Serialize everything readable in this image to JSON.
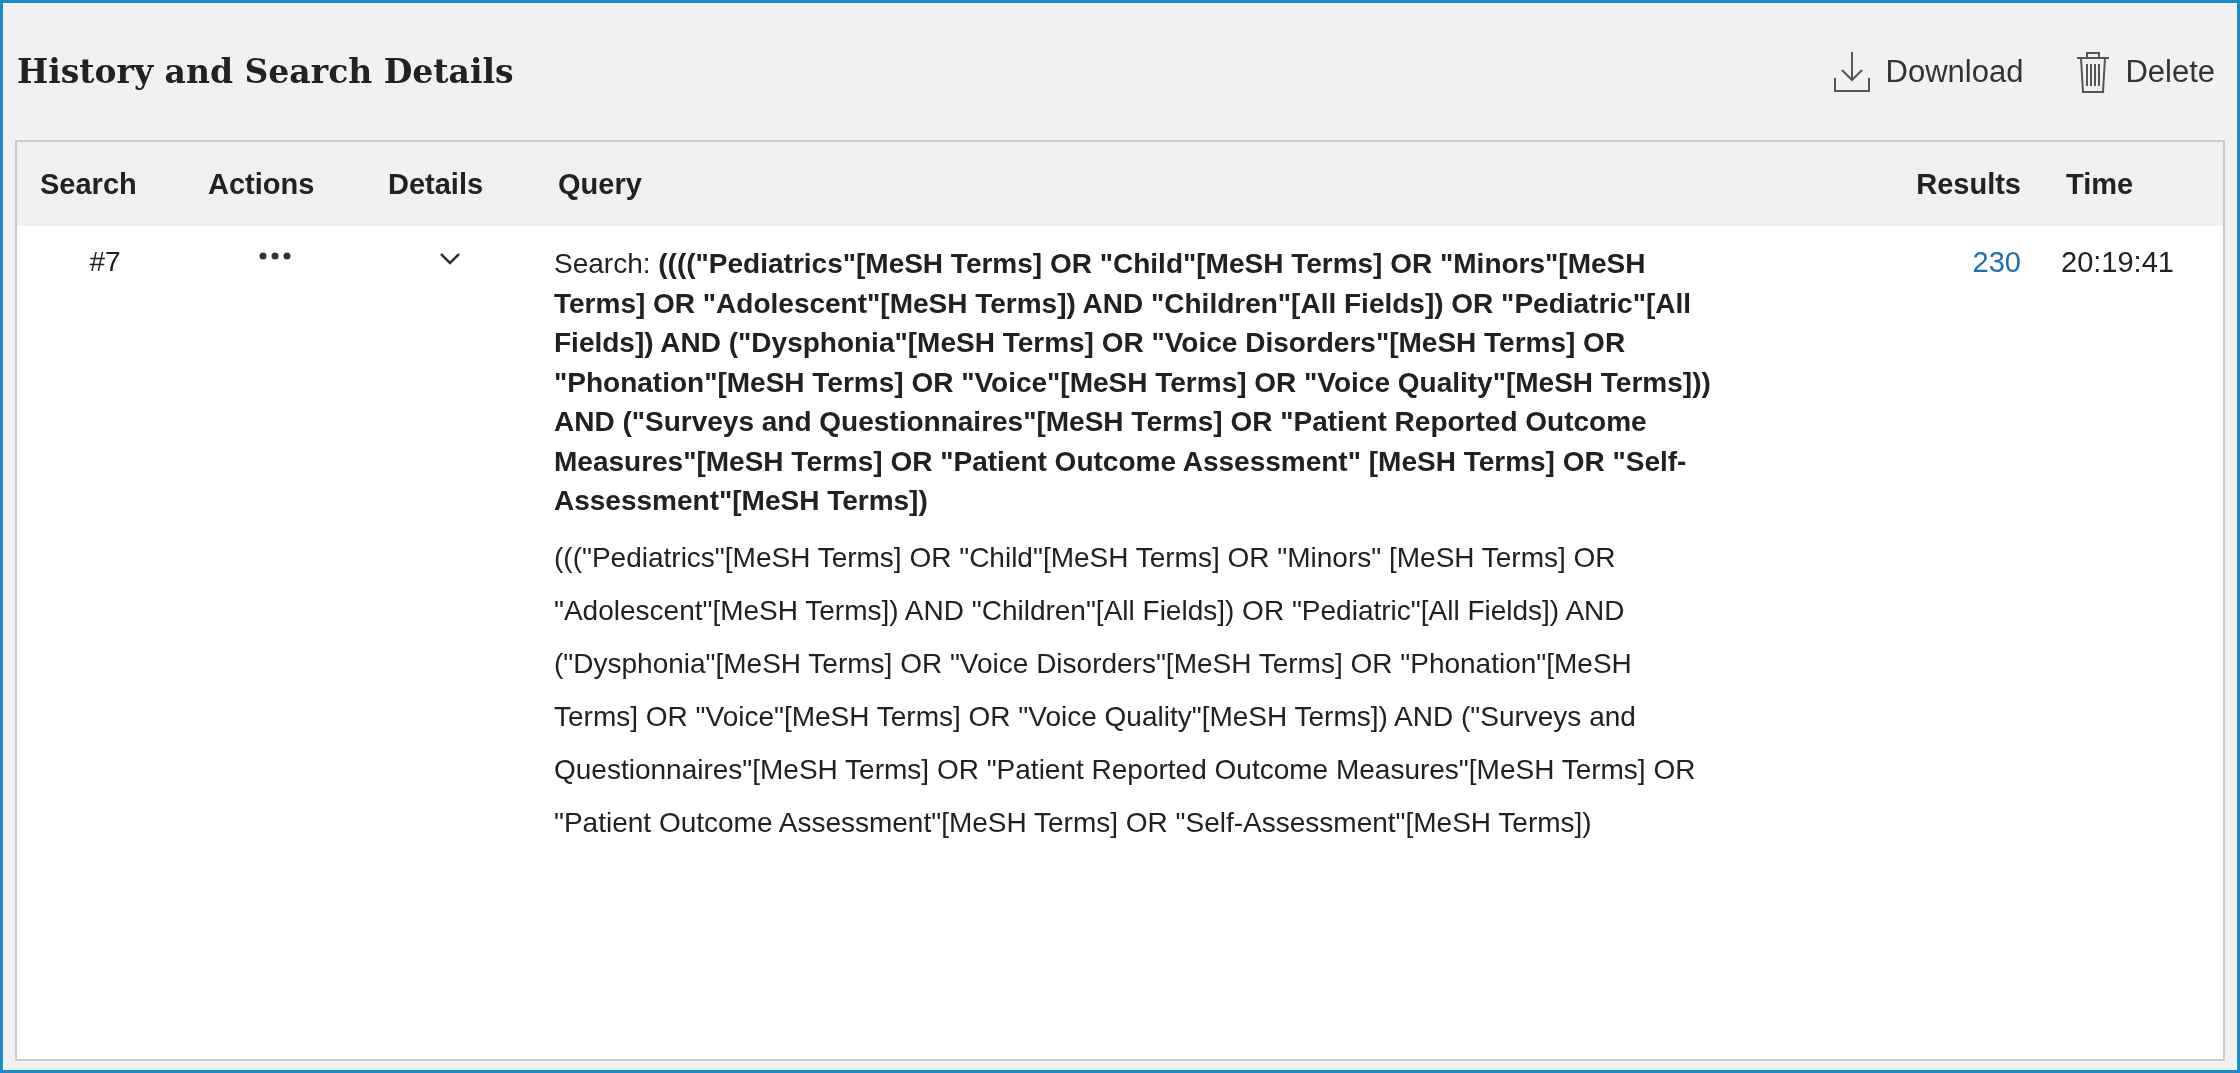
{
  "panel": {
    "title": "History and Search Details",
    "actions": [
      {
        "kind": "download",
        "label": "Download"
      },
      {
        "kind": "delete",
        "label": "Delete"
      }
    ]
  },
  "table": {
    "columns": [
      "Search",
      "Actions",
      "Details",
      "Query",
      "Results",
      "Time"
    ],
    "rows": [
      {
        "search": "#7",
        "expanded": true,
        "query": "Search: **((((\"Pediatrics\"[MeSH Terms] OR \"Child\"[MeSH Terms] OR \"Minors\"[MeSH Terms] OR \"Adolescent\"[MeSH Terms]) AND \"Children\"[All Fields]) OR \"Pediatric\"[All Fields]) AND (\"Dysphonia\"[MeSH Terms] OR \"Voice Disorders\"[MeSH Terms] OR \"Phonation\"[MeSH Terms] OR \"Voice\"[MeSH Terms] OR \"Voice Quality\"[MeSH Terms])) AND (\"Surveys and Questionnaires\"[MeSH Terms] OR \"Patient Reported Outcome Measures\"[MeSH Terms] OR \"Patient Outcome Assessment\" [MeSH Terms] OR \"Self-Assessment\"[MeSH Terms])**",
        "details": "(((\"Pediatrics\"[MeSH Terms] OR \"Child\"[MeSH Terms] OR \"Minors\" [MeSH Terms] OR \"Adolescent\"[MeSH Terms]) AND \"Children\"[All Fields]) OR \"Pediatric\"[All Fields]) AND (\"Dysphonia\"[MeSH Terms] OR \"Voice Disorders\"[MeSH Terms] OR \"Phonation\"[MeSH Terms] OR \"Voice\"[MeSH Terms] OR \"Voice Quality\"[MeSH Terms]) AND (\"Surveys and Questionnaires\"[MeSH Terms] OR \"Patient Reported Outcome Measures\"[MeSH Terms] OR \"Patient Outcome Assessment\"[MeSH Terms] OR \"Self-Assessment\"[MeSH Terms])",
        "results": "230",
        "time": "20:19:41"
      }
    ]
  }
}
